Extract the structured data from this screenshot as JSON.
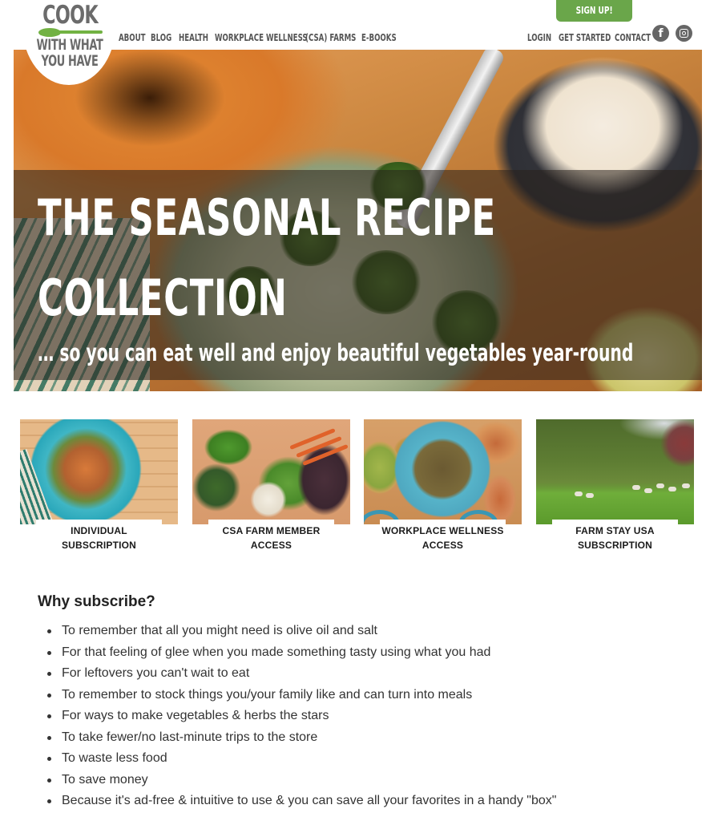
{
  "header": {
    "logo": {
      "line1": "COOK",
      "line2": "WITH WHAT",
      "line3": "YOU HAVE",
      "accent_color": "#72b243"
    },
    "nav_left": [
      {
        "label": "ABOUT"
      },
      {
        "label": "BLOG"
      },
      {
        "label": "HEALTH"
      },
      {
        "label": "WORKPLACE WELLNESS"
      },
      {
        "label": "(CSA) FARMS"
      },
      {
        "label": "E-BOOKS"
      }
    ],
    "nav_right": [
      {
        "label": "LOGIN"
      },
      {
        "label": "GET STARTED"
      },
      {
        "label": "CONTACT"
      }
    ],
    "signup_label": "SIGN UP!",
    "signup_color": "#6aa64a",
    "social": [
      {
        "icon": "facebook-icon",
        "glyph": "f"
      },
      {
        "icon": "instagram-icon"
      }
    ]
  },
  "hero": {
    "title_line1": "THE SEASONAL RECIPE",
    "title_line2": "COLLECTION",
    "subtitle": "… so you can eat well and enjoy beautiful vegetables year-round"
  },
  "cards": [
    {
      "line1": "INDIVIDUAL",
      "line2": "SUBSCRIPTION"
    },
    {
      "line1": "CSA FARM MEMBER",
      "line2": "ACCESS"
    },
    {
      "line1": "WORKPLACE WELLNESS",
      "line2": "ACCESS"
    },
    {
      "line1": "FARM STAY USA",
      "line2": "SUBSCRIPTION"
    }
  ],
  "why": {
    "heading": "Why subscribe?",
    "items": [
      "To remember that all you might need is olive oil and salt",
      "For that feeling of glee when you made something tasty using what you had",
      "For leftovers you can't wait to eat",
      "To remember to stock things you/your family like and can turn into meals",
      "For ways to make vegetables & herbs the stars",
      "To take fewer/no last-minute trips to the store",
      "To waste less food",
      "To save money",
      "Because it's ad-free & intuitive to use & you can save all your favorites in a handy \"box\""
    ]
  }
}
